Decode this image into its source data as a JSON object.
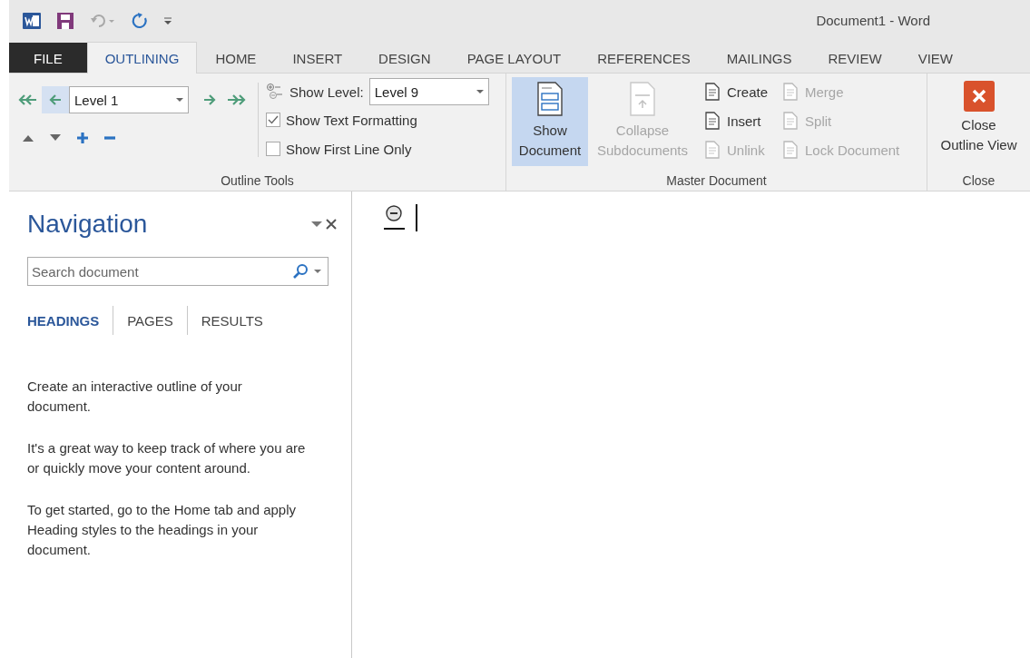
{
  "window": {
    "title": "Document1 - Word"
  },
  "tabs": [
    {
      "label": "FILE",
      "kind": "file",
      "selected": false
    },
    {
      "label": "OUTLINING",
      "kind": "tab",
      "selected": true
    },
    {
      "label": "HOME",
      "kind": "tab",
      "selected": false
    },
    {
      "label": "INSERT",
      "kind": "tab",
      "selected": false
    },
    {
      "label": "DESIGN",
      "kind": "tab",
      "selected": false
    },
    {
      "label": "PAGE LAYOUT",
      "kind": "tab",
      "selected": false
    },
    {
      "label": "REFERENCES",
      "kind": "tab",
      "selected": false
    },
    {
      "label": "MAILINGS",
      "kind": "tab",
      "selected": false
    },
    {
      "label": "REVIEW",
      "kind": "tab",
      "selected": false
    },
    {
      "label": "VIEW",
      "kind": "tab",
      "selected": false
    }
  ],
  "outline_tools": {
    "group_label": "Outline Tools",
    "level_value": "Level 1",
    "show_level_label": "Show Level:",
    "show_level_value": "Level 9",
    "checkboxes": [
      {
        "label": "Show Text Formatting",
        "checked": true
      },
      {
        "label": "Show First Line Only",
        "checked": false
      }
    ]
  },
  "master_document": {
    "group_label": "Master Document",
    "large_buttons": [
      {
        "label": "Show Document",
        "selected": true,
        "disabled": false
      },
      {
        "label": "Collapse Subdocuments",
        "selected": false,
        "disabled": true
      }
    ],
    "small_buttons": [
      {
        "label": "Create",
        "disabled": false
      },
      {
        "label": "Insert",
        "disabled": false
      },
      {
        "label": "Unlink",
        "disabled": true
      },
      {
        "label": "Merge",
        "disabled": true
      },
      {
        "label": "Split",
        "disabled": true
      },
      {
        "label": "Lock Document",
        "disabled": true
      }
    ]
  },
  "close_group": {
    "group_label": "Close",
    "button_label": "Close Outline View"
  },
  "navigation": {
    "title": "Navigation",
    "search_placeholder": "Search document",
    "tabs": [
      {
        "label": "HEADINGS",
        "selected": true
      },
      {
        "label": "PAGES",
        "selected": false
      },
      {
        "label": "RESULTS",
        "selected": false
      }
    ],
    "paragraphs": [
      "Create an interactive outline of your document.",
      "It's a great way to keep track of where you are or quickly move your content around.",
      "To get started, go to the Home tab and apply Heading styles to the headings in your document."
    ]
  }
}
